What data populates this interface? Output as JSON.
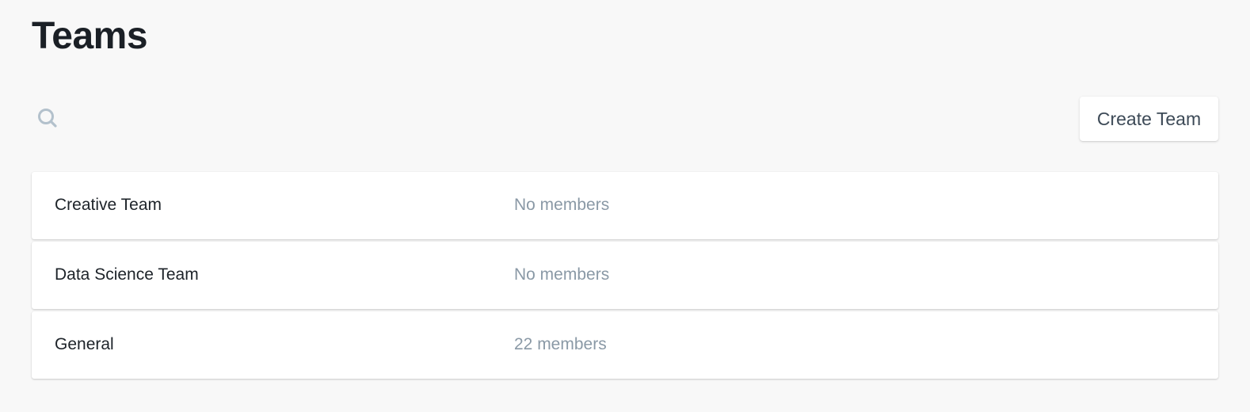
{
  "page": {
    "title": "Teams"
  },
  "toolbar": {
    "search_icon": "search-icon",
    "create_label": "Create Team"
  },
  "teams": [
    {
      "name": "Creative Team",
      "members": "No members"
    },
    {
      "name": "Data Science Team",
      "members": "No members"
    },
    {
      "name": "General",
      "members": "22 members"
    }
  ],
  "colors": {
    "background": "#f8f8f8",
    "title": "#1b2026",
    "muted_text": "#8a99a6",
    "icon": "#b3c1cc",
    "button_text": "#3d4a57"
  }
}
